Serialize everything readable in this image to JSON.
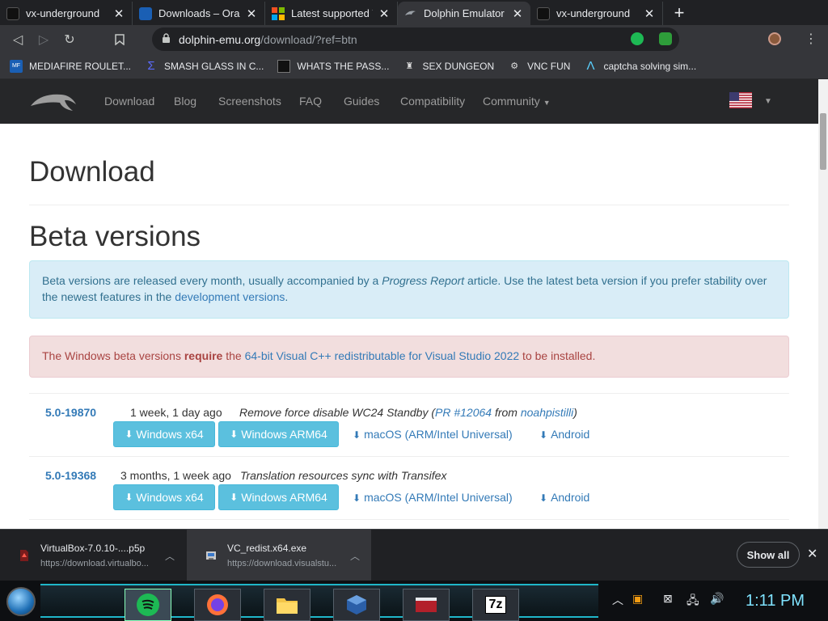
{
  "browser": {
    "tabs": [
      {
        "title": "vx-underground",
        "icon": "vx-underground-favicon",
        "active": false
      },
      {
        "title": "Downloads – Oracle",
        "icon": "virtualbox-favicon",
        "active": false
      },
      {
        "title": "Latest supported Vis",
        "icon": "microsoft-favicon",
        "active": false
      },
      {
        "title": "Dolphin Emulator - D",
        "icon": "dolphin-favicon",
        "active": true
      },
      {
        "title": "vx-underground",
        "icon": "vx-underground-favicon",
        "active": false
      }
    ],
    "url_host": "dolphin-emu.org",
    "url_path": "/download/?ref=btn",
    "bookmarks": [
      {
        "label": "MEDIAFIRE ROULET..."
      },
      {
        "label": "SMASH GLASS IN C..."
      },
      {
        "label": "WHATS THE PASS..."
      },
      {
        "label": "SEX DUNGEON"
      },
      {
        "label": "VNC FUN"
      },
      {
        "label": "captcha solving sim..."
      }
    ]
  },
  "site": {
    "nav": [
      "Download",
      "Blog",
      "Screenshots",
      "FAQ",
      "Guides",
      "Compatibility",
      "Community"
    ],
    "page_title": "Download",
    "section_title": "Beta versions",
    "info": {
      "part1": "Beta versions are released every month, usually accompanied by a ",
      "em": "Progress Report",
      "part2": " article. Use the latest beta version if you prefer stability over the newest features in the ",
      "link": "development versions",
      "part3": "."
    },
    "warning": {
      "part1": "The Windows beta versions ",
      "bold": "require",
      "part2": " the ",
      "link": "64-bit Visual C++ redistributable for Visual Studio 2022",
      "part3": " to be installed."
    },
    "versions": [
      {
        "version": "5.0-19870",
        "date": "1 week, 1 day ago",
        "msg": "Remove force disable WC24 Standby",
        "pr_open": " (",
        "pr": "PR #12064",
        "pr_from": " from ",
        "author": "noahpistilli",
        "pr_close": ")"
      },
      {
        "version": "5.0-19368",
        "date": "3 months, 1 week ago",
        "msg": "Translation resources sync with Transifex"
      }
    ],
    "buttons": {
      "win64": "Windows x64",
      "arm64": "Windows ARM64",
      "mac": "macOS (ARM/Intel Universal)",
      "android": "Android"
    }
  },
  "downloads": {
    "items": [
      {
        "name": "VirtualBox-7.0.10-....p5p",
        "url": "https://download.virtualbo..."
      },
      {
        "name": "VC_redist.x64.exe",
        "url": "https://download.visualstu..."
      }
    ],
    "show_all": "Show all"
  },
  "taskbar": {
    "apps": [
      "spotify-app",
      "firefox-app",
      "file-explorer-app",
      "virtualbox-app",
      "app-window",
      "7zip-app"
    ],
    "label_7z": "7z",
    "clock": "1:11 PM"
  },
  "colors": {
    "site_link": "#337ab7",
    "info_bg": "#d9edf7",
    "danger_bg": "#f2dede",
    "button": "#5bc0de"
  }
}
